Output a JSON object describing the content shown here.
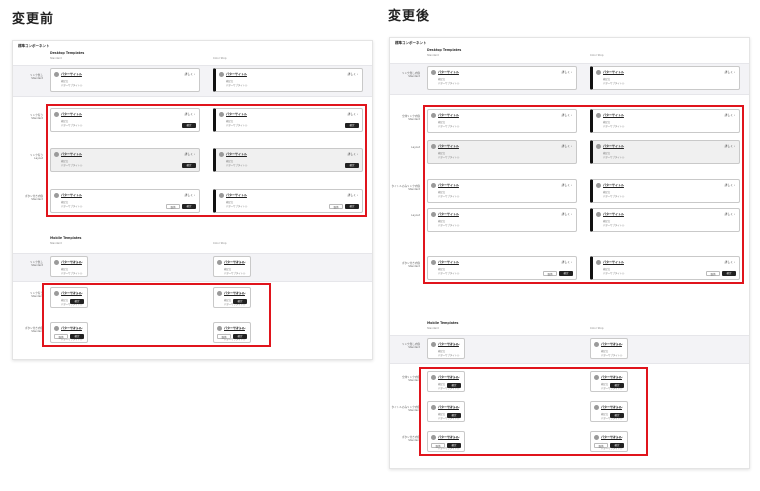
{
  "before": {
    "heading": "変更前",
    "panel_title": "標準コンポーネント",
    "desktop_section": "Desktop Templates",
    "mobile_section": "Mobile Templates",
    "col_standard": "Standard",
    "col_left_stop": "Color Stop",
    "desktop_rows": [
      {
        "label": [
          "リンク無し",
          "Standard"
        ],
        "disabled": false
      },
      {
        "label": [
          "リンク有り",
          "Standard"
        ],
        "disabled": false
      },
      {
        "label": [
          "リンク有り",
          "Layout"
        ],
        "disabled": true
      },
      {
        "label": [
          "ボタン付き内容",
          "Standard"
        ],
        "disabled": false
      }
    ],
    "mobile_rows": [
      {
        "label": [
          "リンク無し",
          "Standard"
        ]
      },
      {
        "label": [
          "リンク有り",
          "Standard"
        ]
      },
      {
        "label": [
          "ボタン付き内容",
          "Standard"
        ]
      }
    ]
  },
  "after": {
    "heading": "変更後",
    "panel_title": "標準コンポーネント",
    "desktop_section": "Desktop Templates",
    "mobile_section": "Mobile Templates",
    "col_standard": "Standard",
    "col_left_stop": "Color Stop",
    "desktop_rows": [
      {
        "label": [
          "リンク無し内容",
          "Standard"
        ],
        "disabled": false
      },
      {
        "label": [
          "全体リンク内容",
          "Standard"
        ],
        "disabled": false
      },
      {
        "label": [
          "",
          "Layout"
        ],
        "disabled": true
      },
      {
        "label": [
          "タイトルのみリンク内容",
          "Standard"
        ],
        "disabled": false
      },
      {
        "label": [
          "",
          "Layout"
        ],
        "disabled": false
      },
      {
        "label": [
          "ボタン付き内容",
          "Standard"
        ],
        "disabled": false
      }
    ],
    "mobile_rows": [
      {
        "label": [
          "リンク無し内容",
          "Standard"
        ]
      },
      {
        "label": [
          "全体リンク内容",
          "Standard"
        ]
      },
      {
        "label": [
          "タイトルのみリンク内容",
          "Standard"
        ]
      },
      {
        "label": [
          "ボタン付き内容",
          "Standard"
        ]
      }
    ]
  },
  "card": {
    "title": "パターサイトル",
    "action": "詳しく ›",
    "line1": "補足文",
    "line2": "パターサブタイトル",
    "btn_cancel": "取消",
    "btn_ok": "確定"
  },
  "colors": {
    "highlight": "#e0141c",
    "dark_button": "#222222",
    "band": "#f3f3f6"
  }
}
